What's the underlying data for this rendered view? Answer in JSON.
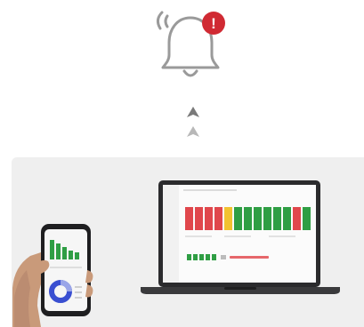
{
  "scene": {
    "description_icons": {
      "bell": "notification-bell-icon",
      "alert_badge": "alert-exclamation-icon",
      "arrows": "chevron-up-icon",
      "laptop": "laptop-icon",
      "phone": "smartphone-icon",
      "hand": "hand-icon"
    },
    "alert_badge_text": "!"
  },
  "colors": {
    "bell_stroke": "#9a9a9a",
    "badge": "#d02a33",
    "arrow_dark": "#7a7a7a",
    "arrow_light": "#b8b8b8",
    "panel_bg": "#efefef",
    "bar_red": "#e0474c",
    "bar_yellow": "#f2c230",
    "bar_green": "#2f9e44",
    "line_red": "#e6676b",
    "donut_blue": "#3a4fd1",
    "donut_light": "#9aa5e8"
  }
}
